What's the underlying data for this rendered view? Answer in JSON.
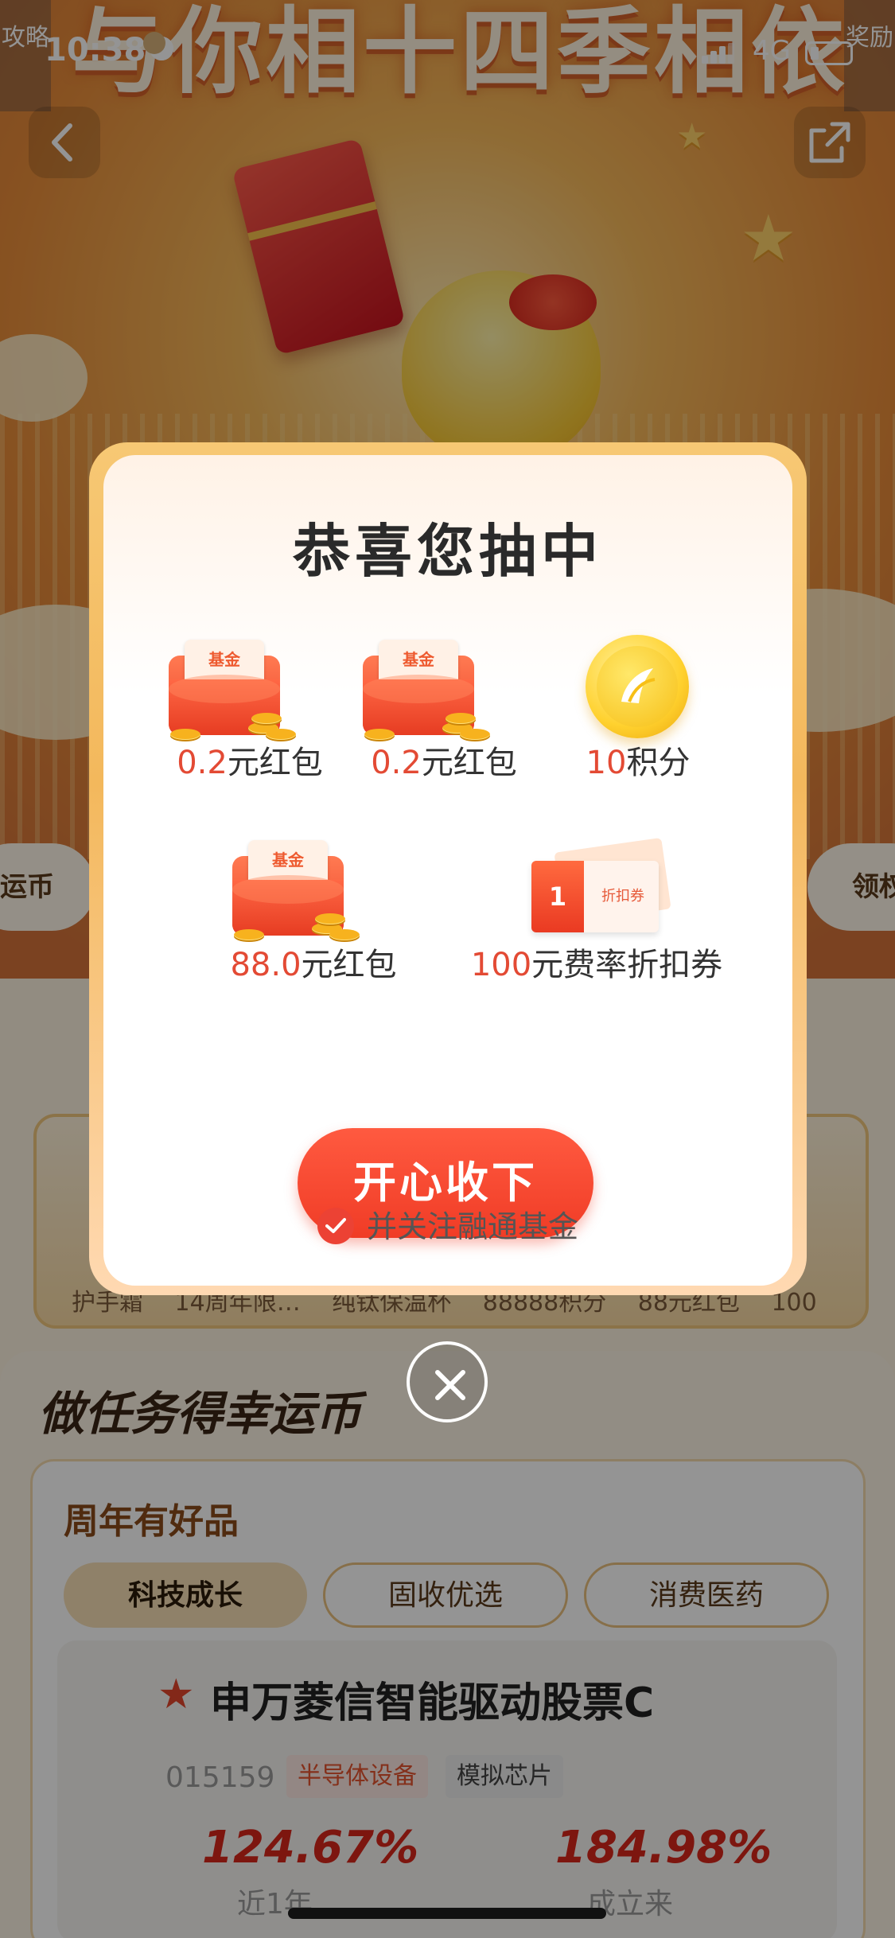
{
  "status_bar": {
    "time": "10:38",
    "network": "4G"
  },
  "banner": {
    "title": "与你相十四季相依"
  },
  "side_buttons": {
    "left_label": "攻略",
    "right_label": "奖励"
  },
  "side_chips": {
    "left": "运币",
    "right": "领权"
  },
  "prize_strip": {
    "labels": "护手霜 14周年限… 纯钛保温杯 88888积分 88元红包 100"
  },
  "modal": {
    "title": "恭喜您抽中",
    "prizes": [
      {
        "amount": "0.2",
        "unit": "元红包",
        "icon": "fund-red-packet-icon",
        "icon_text": "基金"
      },
      {
        "amount": "0.2",
        "unit": "元红包",
        "icon": "fund-red-packet-icon",
        "icon_text": "基金"
      },
      {
        "amount": "10",
        "unit": "积分",
        "icon": "gold-coin-icon"
      },
      {
        "amount": "88.0",
        "unit": "元红包",
        "icon": "fund-red-packet-icon",
        "icon_text": "基金"
      },
      {
        "amount": "100",
        "unit": "元费率折扣券",
        "icon": "discount-voucher-icon",
        "voucher_left": "1",
        "voucher_right": "折扣券"
      }
    ],
    "accept_button": "开心收下",
    "follow_checkbox": {
      "label": "并关注融通基金",
      "checked": true
    }
  },
  "tasks": {
    "section_title": "做任务得幸运币",
    "card_heading": "周年有好品",
    "tabs": [
      {
        "label": "科技成长",
        "active": true
      },
      {
        "label": "固收优选",
        "active": false
      },
      {
        "label": "消费医药",
        "active": false
      }
    ],
    "fund": {
      "name": "申万菱信智能驱动股票C",
      "code": "015159",
      "tags": [
        "半导体设备",
        "模拟芯片"
      ],
      "return_1y": "124.67%",
      "return_1y_label": "近1年",
      "return_since": "184.98%",
      "return_since_label": "成立来"
    }
  },
  "colors": {
    "accent_red": "#f03c26",
    "amount_red": "#e34a34",
    "gold": "#f3b85c"
  }
}
